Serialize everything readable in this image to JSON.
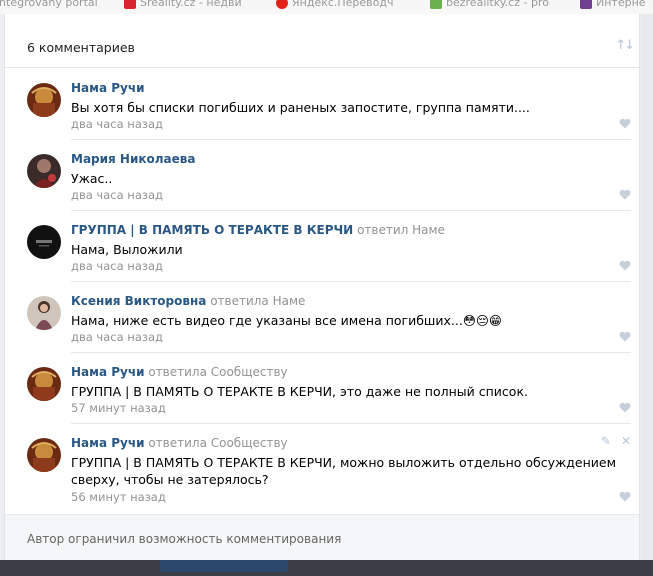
{
  "bookmarks": [
    {
      "label": "integrovany portal",
      "color": "#8c8c8c"
    },
    {
      "label": "Sreality.cz - недви",
      "color": "#d8262e"
    },
    {
      "label": "Яндекс.Переводч",
      "color": "#e2231a"
    },
    {
      "label": "bezrealitky.cz - pro",
      "color": "#6ab04c"
    },
    {
      "label": "Интерне",
      "color": "#6e3f8f"
    }
  ],
  "comments_header": {
    "count_label": "6 комментариев",
    "sort_icon": "sort-arrows-icon"
  },
  "comments": [
    {
      "author": "Нама Ручи",
      "reply_to": "",
      "text": "Вы хотя бы списки погибших и раненых запостите, группа памяти....",
      "time": "два часа назад",
      "avatar": "avatar-nama"
    },
    {
      "author": "Мария Николаева",
      "reply_to": "",
      "text": "Ужас..",
      "time": "два часа назад",
      "avatar": "avatar-maria"
    },
    {
      "author": "ГРУППА | В ПАМЯТЬ О ТЕРАКТЕ В КЕРЧИ",
      "reply_to": "ответил Наме",
      "text": "Нама, Выложили",
      "time": "два часа назад",
      "avatar": "avatar-group"
    },
    {
      "author": "Ксения Викторовна",
      "reply_to": "ответила Наме",
      "text": "Нама, ниже есть видео где указаны все имена погибших...",
      "emoji": "😳😔😁",
      "time": "два часа назад",
      "avatar": "avatar-ksenia"
    },
    {
      "author": "Нама Ручи",
      "reply_to": "ответила Сообществу",
      "text": "ГРУППА | В ПАМЯТЬ О ТЕРАКТЕ В КЕРЧИ, это даже не полный список.",
      "time": "57 минут назад",
      "avatar": "avatar-nama"
    },
    {
      "author": "Нама Ручи",
      "reply_to": "ответила Сообществу",
      "text": "ГРУППА | В ПАМЯТЬ О ТЕРАКТЕ В КЕРЧИ, можно выложить отдельно обсуждением сверху, чтобы не затерялось?",
      "time": "56 минут назад",
      "avatar": "avatar-nama"
    }
  ],
  "footer": {
    "notice": "Автор ограничил возможность комментирования"
  },
  "colors": {
    "link": "#2a5885",
    "muted": "#939393",
    "separator": "#e7e8ec",
    "like": "#c5d0db"
  }
}
